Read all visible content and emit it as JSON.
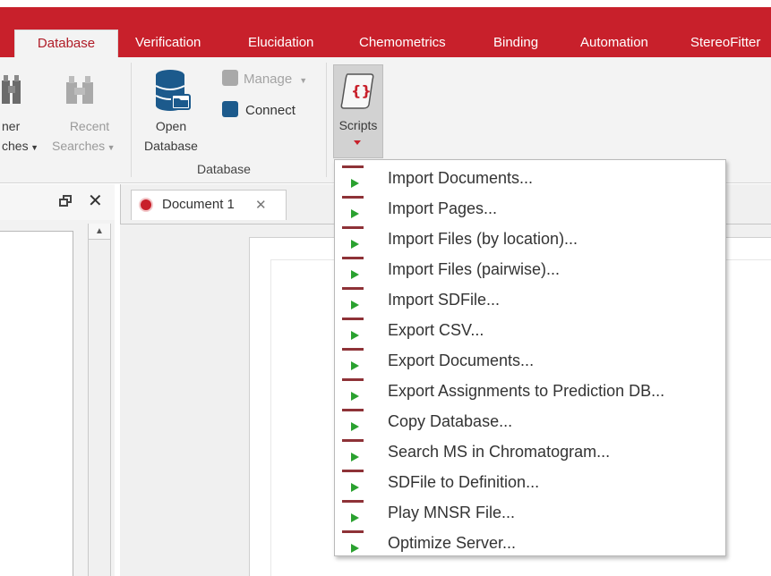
{
  "tabs": [
    {
      "label": "Database",
      "active": true
    },
    {
      "label": "Verification"
    },
    {
      "label": "Elucidation"
    },
    {
      "label": "Chemometrics"
    },
    {
      "label": "Binding"
    },
    {
      "label": "Automation"
    },
    {
      "label": "StereoFitter"
    }
  ],
  "ribbon": {
    "other_searches": {
      "line1": "ner",
      "line2": "ches"
    },
    "recent_searches": {
      "line1": "Recent",
      "line2": "Searches"
    },
    "open_database": {
      "line1": "Open",
      "line2": "Database"
    },
    "manage_label": "Manage",
    "connect_label": "Connect",
    "scripts_label": "Scripts",
    "database_group_label": "Database"
  },
  "document_tab": {
    "label": "Document 1"
  },
  "scripts_menu": [
    {
      "label": "Import Documents..."
    },
    {
      "label": "Import Pages..."
    },
    {
      "label": "Import Files (by location)..."
    },
    {
      "label": "Import Files (pairwise)..."
    },
    {
      "label": "Import SDFile..."
    },
    {
      "label": "Export CSV..."
    },
    {
      "label": "Export Documents..."
    },
    {
      "label": "Export Assignments to Prediction DB..."
    },
    {
      "label": "Copy Database..."
    },
    {
      "label": "Search MS in Chromatogram..."
    },
    {
      "label": "SDFile to Definition..."
    },
    {
      "label": "Play MNSR File..."
    },
    {
      "label": "Optimize Server..."
    }
  ],
  "colors": {
    "ribbon_red": "#c8202b",
    "script_play_green": "#2aa12f"
  }
}
